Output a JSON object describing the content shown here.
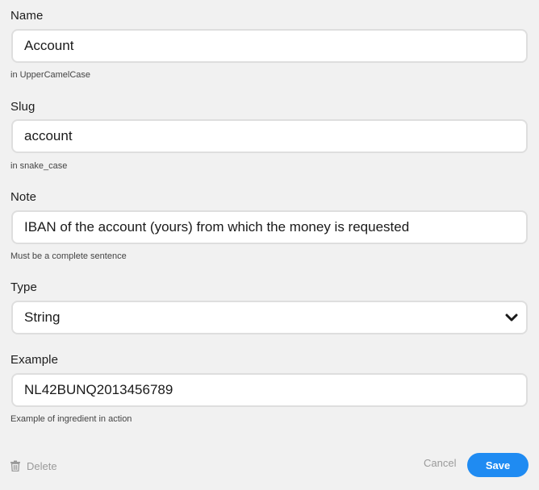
{
  "fields": {
    "name": {
      "label": "Name",
      "value": "Account",
      "hint": "in UpperCamelCase"
    },
    "slug": {
      "label": "Slug",
      "value": "account",
      "hint": "in snake_case"
    },
    "note": {
      "label": "Note",
      "value": "IBAN of the account (yours) from which the money is requested",
      "hint": "Must be a complete sentence"
    },
    "type": {
      "label": "Type",
      "selected": "String",
      "icon": "chevron-down-icon"
    },
    "example": {
      "label": "Example",
      "value": "NL42BUNQ2013456789",
      "hint": "Example of ingredient in action"
    }
  },
  "actions": {
    "delete_label": "Delete",
    "delete_icon": "trash-icon",
    "cancel_label": "Cancel",
    "save_label": "Save"
  },
  "colors": {
    "background": "#f1f1f1",
    "field_border": "#dedede",
    "save_button": "#1f8bf2",
    "muted_text": "#9a9a9a"
  }
}
